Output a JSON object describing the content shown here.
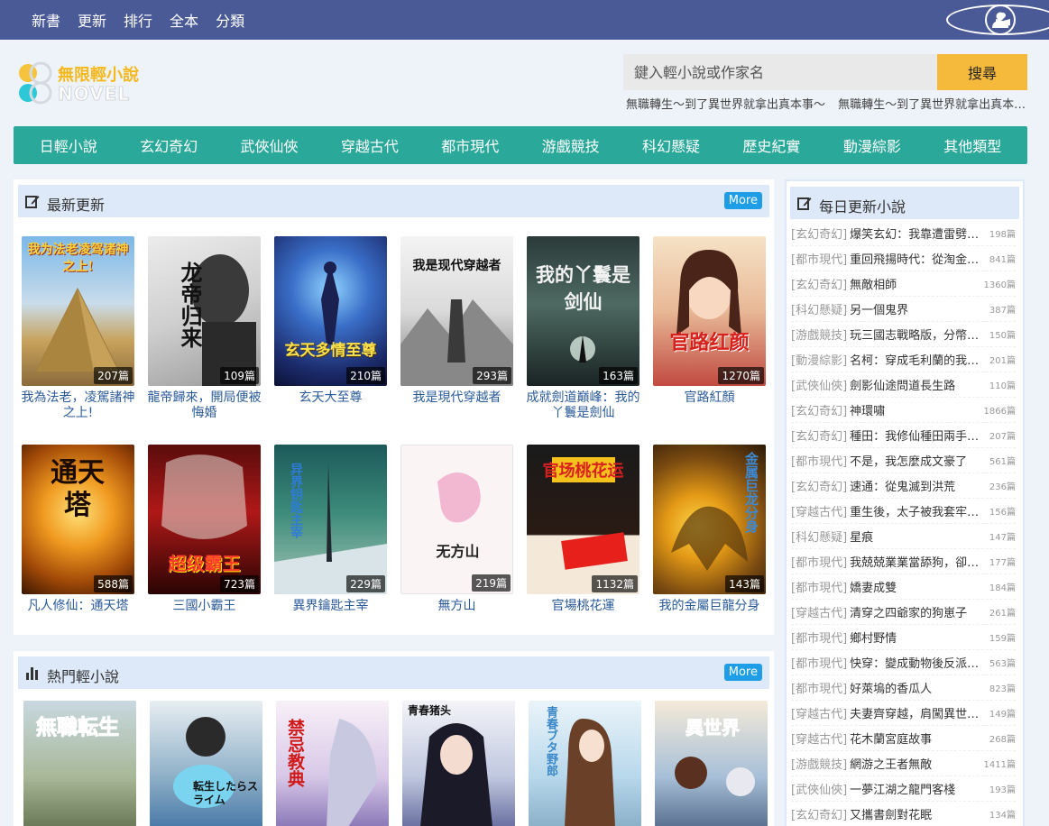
{
  "topnav": [
    "新書",
    "更新",
    "排行",
    "全本",
    "分類"
  ],
  "logo": {
    "name": "無限輕小說",
    "sub": "NOVEL"
  },
  "search": {
    "placeholder": "鍵入輕小說或作家名",
    "button": "搜尋"
  },
  "hotwords": [
    "無職轉生～到了異世界就拿出真本事～",
    "無職轉生～到了異世界就拿出真本事～"
  ],
  "categories": [
    "日輕小說",
    "玄幻奇幻",
    "武俠仙俠",
    "穿越古代",
    "都市現代",
    "游戲競技",
    "科幻懸疑",
    "歷史紀實",
    "動漫綜影",
    "其他類型"
  ],
  "latest": {
    "title": "最新更新",
    "more": "More",
    "books": [
      {
        "name": "我為法老，凌駕諸神之上!",
        "count": "207篇",
        "cover": "我为法老凌驾诸神之上!"
      },
      {
        "name": "龍帝歸來，開局便被悔婚",
        "count": "109篇",
        "cover": "龙帝归来"
      },
      {
        "name": "玄天大至尊",
        "count": "210篇",
        "cover": "玄天多情至尊"
      },
      {
        "name": "我是現代穿越者",
        "count": "293篇",
        "cover": "我是现代穿越者"
      },
      {
        "name": "成就劍道巔峰：我的丫鬟是劍仙",
        "count": "163篇",
        "cover": "我的丫鬟是剑仙"
      },
      {
        "name": "官路紅顏",
        "count": "1270篇",
        "cover": "官路红颜"
      },
      {
        "name": "凡人修仙：通天塔",
        "count": "588篇",
        "cover": "通天塔"
      },
      {
        "name": "三國小霸王",
        "count": "723篇",
        "cover": "超级霸王"
      },
      {
        "name": "異界鑰匙主宰",
        "count": "229篇",
        "cover": "异界钥匙主宰"
      },
      {
        "name": "無方山",
        "count": "219篇",
        "cover": "无方山"
      },
      {
        "name": "官場桃花運",
        "count": "1132篇",
        "cover": "官场桃花运"
      },
      {
        "name": "我的金屬巨龍分身",
        "count": "143篇",
        "cover": "金属巨龙分身"
      }
    ]
  },
  "hot": {
    "title": "熱門輕小說",
    "more": "More",
    "books": [
      {
        "cover": "無職転生"
      },
      {
        "cover": "転生したらスライム"
      },
      {
        "cover": "禁忌教典"
      },
      {
        "cover": "青春猪头"
      },
      {
        "cover": "青春ブタ野郎"
      },
      {
        "cover": "異世界"
      }
    ]
  },
  "daily": {
    "title": "每日更新小說",
    "items": [
      {
        "cat": "[玄幻奇幻]",
        "title": "爆笑玄幻：我靠遭雷劈…",
        "count": "198篇"
      },
      {
        "cat": "[都市現代]",
        "title": "重回飛揚時代：從淘金…",
        "count": "841篇"
      },
      {
        "cat": "[玄幻奇幻]",
        "title": "無敵相師",
        "count": "1360篇"
      },
      {
        "cat": "[科幻懸疑]",
        "title": "另一個鬼界",
        "count": "387篇"
      },
      {
        "cat": "[游戲競技]",
        "title": "玩三國志戰略版，分幣…",
        "count": "150篇"
      },
      {
        "cat": "[動漫綜影]",
        "title": "名柯：穿成毛利蘭的我…",
        "count": "201篇"
      },
      {
        "cat": "[武俠仙俠]",
        "title": "劍影仙途問道長生路",
        "count": "110篇"
      },
      {
        "cat": "[玄幻奇幻]",
        "title": "神環嘯",
        "count": "1866篇"
      },
      {
        "cat": "[玄幻奇幻]",
        "title": "種田：我修仙種田兩手…",
        "count": "207篇"
      },
      {
        "cat": "[都市現代]",
        "title": "不是，我怎麼成文豪了",
        "count": "561篇"
      },
      {
        "cat": "[玄幻奇幻]",
        "title": "速通：從鬼滅到洪荒",
        "count": "236篇"
      },
      {
        "cat": "[穿越古代]",
        "title": "重生後，太子被我套牢…",
        "count": "156篇"
      },
      {
        "cat": "[科幻懸疑]",
        "title": "星痕",
        "count": "147篇"
      },
      {
        "cat": "[都市現代]",
        "title": "我兢兢業業當舔狗，卻…",
        "count": "177篇"
      },
      {
        "cat": "[都市現代]",
        "title": "嬌妻成雙",
        "count": "184篇"
      },
      {
        "cat": "[穿越古代]",
        "title": "清穿之四爺家的狗崽子",
        "count": "261篇"
      },
      {
        "cat": "[都市現代]",
        "title": "鄉村野情",
        "count": "159篇"
      },
      {
        "cat": "[都市現代]",
        "title": "快穿：變成動物後反派…",
        "count": "563篇"
      },
      {
        "cat": "[都市現代]",
        "title": "好萊塢的香瓜人",
        "count": "823篇"
      },
      {
        "cat": "[穿越古代]",
        "title": "夫妻齊穿越，肩闖異世…",
        "count": "149篇"
      },
      {
        "cat": "[穿越古代]",
        "title": "花木蘭宮庭故事",
        "count": "268篇"
      },
      {
        "cat": "[游戲競技]",
        "title": "網游之王者無敵",
        "count": "1411篇"
      },
      {
        "cat": "[武俠仙俠]",
        "title": "一夢江湖之龍門客棧",
        "count": "193篇"
      },
      {
        "cat": "[玄幻奇幻]",
        "title": "又攜書劍對花眠",
        "count": "134篇"
      }
    ]
  }
}
